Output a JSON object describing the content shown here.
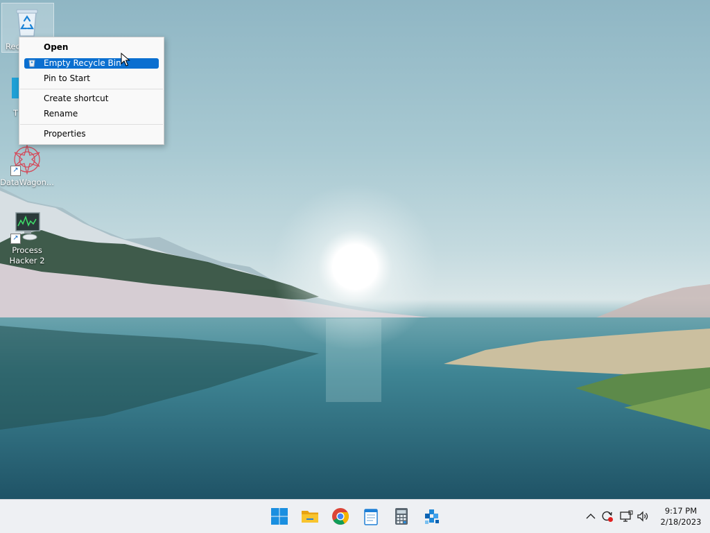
{
  "desktop": {
    "icons": [
      {
        "label": "Rec"
      },
      {
        "label": "T"
      },
      {
        "label": "DataWagon..."
      },
      {
        "label": "Process Hacker 2"
      }
    ]
  },
  "context_menu": {
    "items": [
      {
        "label": "Open"
      },
      {
        "label": "Empty Recycle Bin"
      },
      {
        "label": "Pin to Start"
      },
      {
        "label": "Create shortcut"
      },
      {
        "label": "Rename"
      },
      {
        "label": "Properties"
      }
    ],
    "highlight_color": "#0a6fd0"
  },
  "taskbar": {
    "apps": [
      "windows-start-icon",
      "file-explorer-icon",
      "chrome-icon",
      "notepad-icon",
      "calculator-icon",
      "azure-data-icon"
    ],
    "tray": {
      "time": "9:17 PM",
      "date": "2/18/2023"
    }
  }
}
